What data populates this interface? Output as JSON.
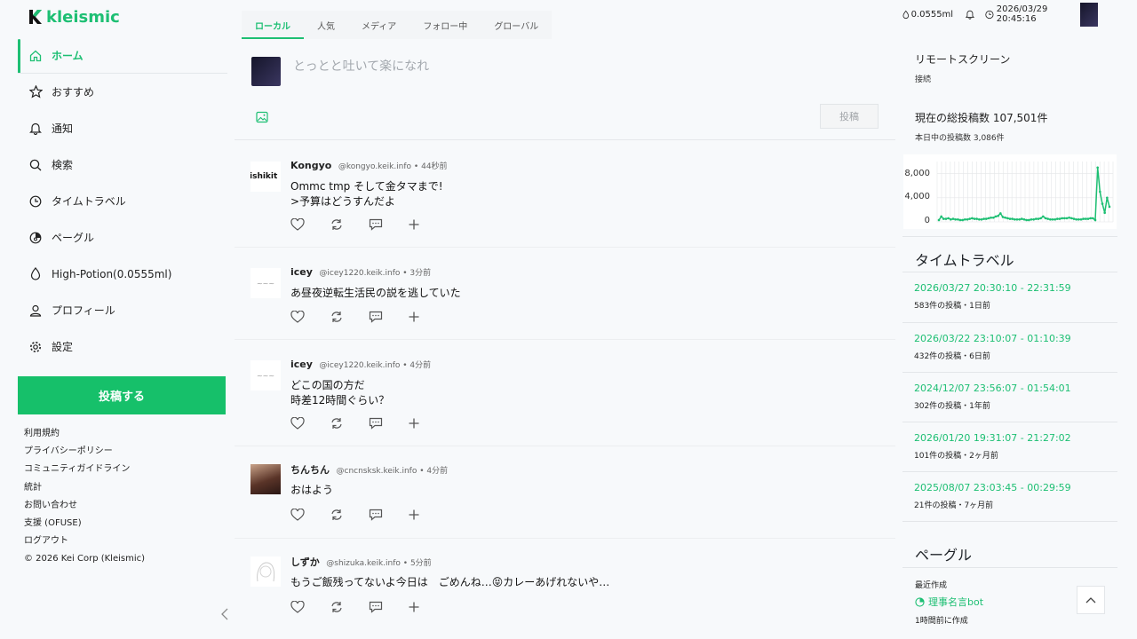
{
  "app": {
    "logo_text": "kleismic"
  },
  "sidebar": {
    "items": [
      {
        "label": "ホーム",
        "icon": "home-icon"
      },
      {
        "label": "おすすめ",
        "icon": "star-icon"
      },
      {
        "label": "通知",
        "icon": "bell-icon"
      },
      {
        "label": "検索",
        "icon": "search-icon"
      },
      {
        "label": "タイムトラベル",
        "icon": "clock-icon"
      },
      {
        "label": "ペーグル",
        "icon": "pagle-icon"
      },
      {
        "label": "High-Potion(0.0555ml)",
        "icon": "drop-icon"
      },
      {
        "label": "プロフィール",
        "icon": "user-icon"
      },
      {
        "label": "設定",
        "icon": "gear-icon"
      }
    ],
    "post_button": "投稿する",
    "links": [
      "利用規約",
      "プライバシーポリシー",
      "コミュニティガイドライン",
      "統計",
      "お問い合わせ",
      "支援 (OFUSE)",
      "ログアウト"
    ],
    "copyright": "© 2026 Kei Corp (Kleismic)"
  },
  "timeline": {
    "tabs": [
      "ローカル",
      "人気",
      "メディア",
      "フォロー中",
      "グローバル"
    ],
    "composer": {
      "placeholder": "とっとと吐いて楽になれ",
      "submit": "投稿"
    },
    "posts": [
      {
        "name": "Kongyo",
        "handle": "@kongyo.keik.info",
        "time": "44秒前",
        "body": "Ommc tmp そして金タマまで!\n>予算はどうすんだよ",
        "avatar_text": "ishikit"
      },
      {
        "name": "icey",
        "handle": "@icey1220.keik.info",
        "time": "3分前",
        "body": "あ昼夜逆転生活民の説を逃していた",
        "avatar_text": "~~~"
      },
      {
        "name": "icey",
        "handle": "@icey1220.keik.info",
        "time": "4分前",
        "body": "どこの国の方だ\n時差12時間ぐらい？",
        "avatar_text": "~~~"
      },
      {
        "name": "ちんちん",
        "handle": "@cncnsksk.keik.info",
        "time": "4分前",
        "body": "おはよう",
        "avatar_text": ""
      },
      {
        "name": "しずか",
        "handle": "@shizuka.keik.info",
        "time": "5分前",
        "body": "もうご飯残ってないよ今日は　ごめんね…😝カレーあげれないや…",
        "avatar_text": ""
      }
    ]
  },
  "topbar": {
    "potion": "0.0555ml",
    "datetime": "2026/03/29 20:45:16"
  },
  "right": {
    "remote": {
      "title": "リモートスクリーン",
      "status": "接続"
    },
    "stats": {
      "title": "現在の総投稿数 107,501件",
      "sub": "本日中の投稿数 3,086件"
    },
    "timetravel": {
      "title": "タイムトラベル",
      "items": [
        {
          "range": "2026/03/27 20:30:10 - 22:31:59",
          "meta": "583件の投稿・1日前"
        },
        {
          "range": "2026/03/22 23:10:07 - 01:10:39",
          "meta": "432件の投稿・6日前"
        },
        {
          "range": "2024/12/07 23:56:07 - 01:54:01",
          "meta": "302件の投稿・1年前"
        },
        {
          "range": "2026/01/20 19:31:07 - 21:27:02",
          "meta": "101件の投稿・2ヶ月前"
        },
        {
          "range": "2025/08/07 23:03:45 - 00:29:59",
          "meta": "21件の投稿・7ヶ月前"
        }
      ]
    },
    "pagle": {
      "title": "ペーグル",
      "recent": "最近作成",
      "bot": "理事名言bot",
      "ago": "1時間前に作成"
    }
  },
  "chart_data": {
    "type": "line",
    "yticks": [
      "8,000",
      "4,000",
      "0"
    ],
    "ylim": [
      0,
      10000
    ],
    "series": [
      {
        "values": [
          300,
          900,
          500,
          500,
          600,
          400,
          500,
          400,
          400,
          300,
          300,
          400,
          400,
          500,
          600,
          500,
          500,
          400,
          400,
          500,
          500,
          600,
          700,
          700,
          900,
          1000,
          1400,
          800,
          700,
          600,
          500,
          500,
          400,
          400,
          400,
          500,
          400,
          300,
          300,
          400,
          400,
          500,
          500,
          600,
          900,
          600,
          500,
          400,
          400,
          400,
          500,
          500,
          600,
          600,
          600,
          700,
          600,
          500,
          400,
          400,
          400,
          500,
          500,
          500,
          600,
          600,
          300,
          9000,
          5000,
          3000,
          1500,
          4000,
          2500
        ]
      }
    ],
    "color": "#1dbf73",
    "grid": true
  }
}
